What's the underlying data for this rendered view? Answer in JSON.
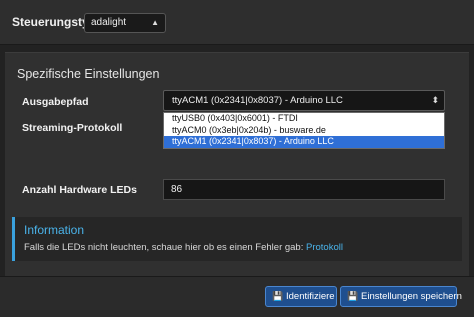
{
  "topbar": {
    "label": "Steuerungstyp:",
    "select_value": "adalight"
  },
  "section": {
    "title": "Spezifische Einstellungen",
    "output_path": {
      "label": "Ausgabepfad",
      "selected": "ttyACM1 (0x2341|0x8037) - Arduino LLC",
      "options": [
        "ttyUSB0 (0x403|0x6001) - FTDI",
        "ttyACM0 (0x3eb|0x204b) - busware.de",
        "ttyACM1 (0x2341|0x8037) - Arduino LLC"
      ]
    },
    "streaming_protocol": {
      "label": "Streaming-Protokoll"
    },
    "hardware_leds": {
      "label": "Anzahl Hardware LEDs",
      "value": "86"
    }
  },
  "info": {
    "title": "Information",
    "text": "Falls die LEDs nicht leuchten, schaue hier ob es einen Fehler gab:",
    "link": "Protokoll"
  },
  "footer": {
    "identify_label": "Identifiziere",
    "save_label": "Einstellungen speichern"
  },
  "icons": {
    "caret": "sort-caret-icon",
    "save": "floppy-disk-icon"
  },
  "colors": {
    "accent": "#3aa1dd",
    "selected_option": "#2f6fd6",
    "button": "#1f4f8f"
  }
}
